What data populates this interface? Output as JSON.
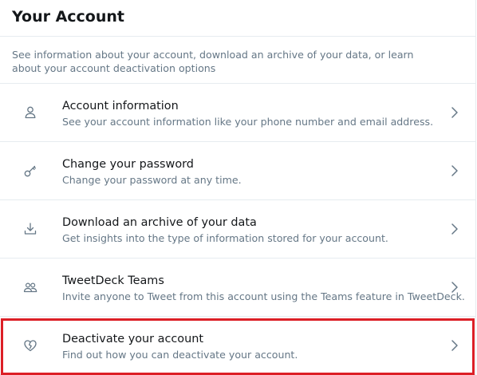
{
  "header": {
    "title": "Your Account"
  },
  "intro": {
    "text": "See information about your account, download an archive of your data, or learn about your account deactivation options"
  },
  "items": [
    {
      "icon": "person-icon",
      "title": "Account information",
      "description": "See your account information like your phone number and email address."
    },
    {
      "icon": "key-icon",
      "title": "Change your password",
      "description": "Change your password at any time."
    },
    {
      "icon": "download-icon",
      "title": "Download an archive of your data",
      "description": "Get insights into the type of information stored for your account."
    },
    {
      "icon": "people-icon",
      "title": "TweetDeck Teams",
      "description": "Invite anyone to Tweet from this account using the Teams feature in TweetDeck."
    },
    {
      "icon": "broken-heart-icon",
      "title": "Deactivate your account",
      "description": "Find out how you can deactivate your account."
    }
  ],
  "colors": {
    "primary_text": "#14171a",
    "secondary_text": "#657786",
    "divider": "#e6ecf0",
    "highlight_border": "#dc1f26"
  }
}
